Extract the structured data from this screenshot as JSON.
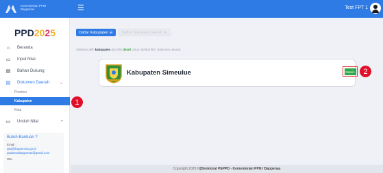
{
  "header": {
    "brand_line1": "Kementerian PPN/",
    "brand_line2": "Bappenas",
    "menu_icon": "hamburger-icon",
    "user_name": "Test FPT 1",
    "avatar_icon": "user-circle-icon"
  },
  "sidebar": {
    "logo_ppd": "PPD",
    "logo_20": "20",
    "logo_2": "2",
    "logo_5": "5",
    "items": [
      {
        "label": "Beranda",
        "icon": "home-icon"
      },
      {
        "label": "Input Nilai",
        "icon": "monitor-icon"
      },
      {
        "label": "Bahan Dukung",
        "icon": "document-icon"
      },
      {
        "label": "Dokumen Daerah",
        "icon": "document-icon"
      },
      {
        "label": "Unduh Nilai",
        "icon": "monitor-icon"
      }
    ],
    "sub_items": [
      {
        "label": "Provinsi"
      },
      {
        "label": "Kabupaten"
      },
      {
        "label": "Kota"
      }
    ],
    "help": {
      "title": "Butuh Bantuan ?",
      "email_label": "Email :",
      "email1": "ppd@bappenas.go.id",
      "email2": "ppd2023bappenas@gmail.com",
      "wa_label": "Wa :"
    }
  },
  "main": {
    "tabs": [
      {
        "label": "Daftar Kabupaten ☰"
      },
      {
        "label": "Daftar Dokumen Daerah ☰"
      }
    ],
    "hint_before": "Silahkan pilih ",
    "hint_kab": "kabupaten",
    "hint_mid": " dan klik ",
    "hint_detail": "detail",
    "hint_after": " untuk melihat file / dokumen daerah.",
    "card": {
      "name": "Kabupaten Simeulue",
      "detail_label": "Detail ›"
    }
  },
  "markers": [
    "1",
    "2"
  ],
  "footer": {
    "prefix": "Copyright 2025 © ",
    "org": "[Direktorat PEPPD - Kementerian PPN / Bappenas"
  }
}
